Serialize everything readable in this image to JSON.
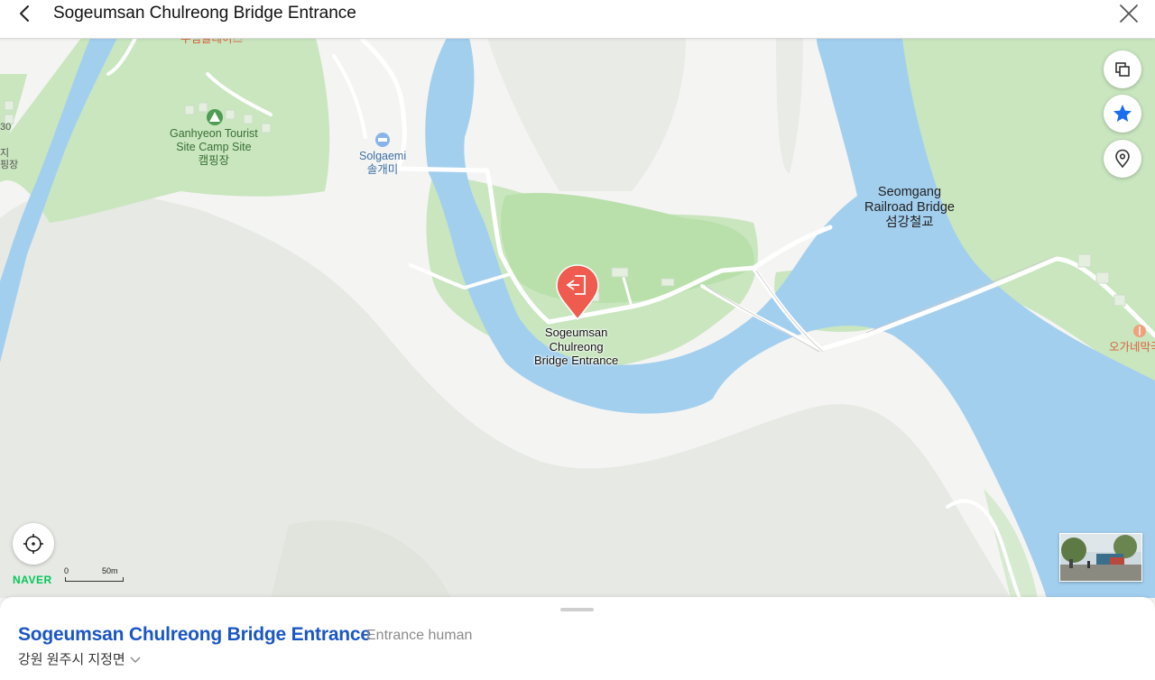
{
  "header": {
    "title": "Sogeumsan Chulreong Bridge Entrance",
    "back_icon": "chevron-left-icon",
    "close_icon": "close-icon"
  },
  "map": {
    "labels": {
      "campsite": [
        "Ganhyeon Tourist",
        "Site Camp Site",
        "캠핑장"
      ],
      "solgaemi": [
        "Solgaemi",
        "솔개미"
      ],
      "railroad_bridge": [
        "Seomgang",
        "Railroad Bridge",
        "섬강철교"
      ],
      "destination": [
        "Sogeumsan",
        "Chulreong",
        "Bridge Entrance"
      ],
      "restaurant": "오가네막국",
      "top_partial": "두럼글레이즈",
      "left_edge_1": "30",
      "left_edge_2": "지",
      "left_edge_3": "핑장"
    },
    "controls": {
      "layers_icon": "layers-icon",
      "favorite_icon": "star-icon",
      "pin_icon": "location-pin-icon",
      "locate_icon": "crosshair-icon"
    },
    "brand": "NAVER",
    "scale": {
      "start": "0",
      "end": "50m"
    },
    "colors": {
      "water": "#a3cfef",
      "park": "#c9e6bf",
      "park_dark": "#b5dca8",
      "land": "#f4f4f2",
      "terrain": "#e7e9e4",
      "road": "#ffffff",
      "marker": "#ef5b4f"
    }
  },
  "sheet": {
    "place_name": "Sogeumsan Chulreong Bridge Entrance",
    "category": "Entrance human",
    "address": "강원 원주시 지정면",
    "expand_icon": "chevron-down-icon"
  }
}
